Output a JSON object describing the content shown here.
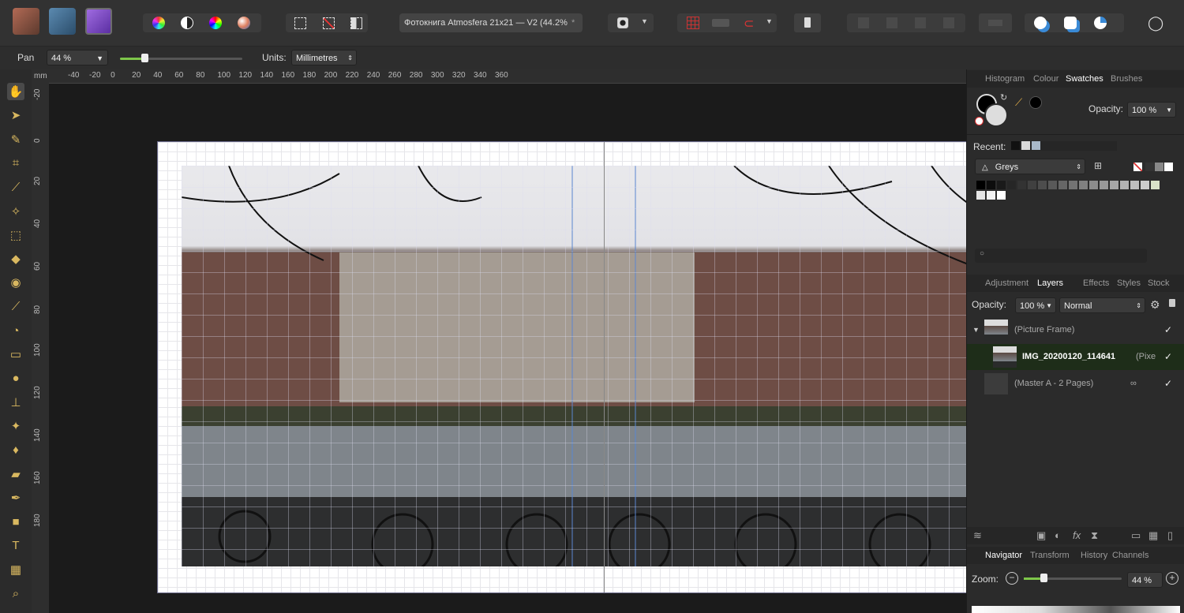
{
  "toolbar": {
    "personas": [
      "photo-persona",
      "designer-persona",
      "publisher-persona"
    ],
    "document_title": "Фотокнига Atmosfera 21x21 — V2 (44.2%",
    "modified_mark": "*",
    "dropdown_glyph": "▼"
  },
  "context": {
    "tool": "Pan",
    "zoom_value": "44 %",
    "zoom_slider_level": 0.2,
    "units_label": "Units:",
    "units_value": "Millimetres"
  },
  "ruler": {
    "unit": "mm",
    "h_labels": [
      "-40",
      "-20",
      "0",
      "20",
      "40",
      "60",
      "80",
      "100",
      "120",
      "140",
      "160",
      "180",
      "200",
      "220",
      "240",
      "260",
      "280",
      "300",
      "320",
      "340",
      "360"
    ],
    "v_labels": [
      "-20",
      "0",
      "20",
      "40",
      "60",
      "80",
      "100",
      "120",
      "140",
      "160",
      "180"
    ]
  },
  "tools": [
    "hand-icon",
    "pointer-icon",
    "eyedropper-icon",
    "crop-icon",
    "brush-icon",
    "wand-icon",
    "marquee-icon",
    "fill-icon",
    "color-picker-icon",
    "paint-icon",
    "recolor-icon",
    "eraser-icon",
    "search-icon",
    "stamp-icon",
    "retouch-icon",
    "drop-icon",
    "bandage-icon",
    "pen-icon",
    "rectangle-icon",
    "text-icon",
    "grid-icon",
    "zoom-icon"
  ],
  "swatches_panel": {
    "tabs": [
      "Histogram",
      "Colour",
      "Swatches",
      "Brushes"
    ],
    "active_tab": "Swatches",
    "opacity_label": "Opacity:",
    "opacity_value": "100 %",
    "recent_label": "Recent:",
    "recent_colors": [
      "#111111",
      "#d9d9d9",
      "#a9b9c9"
    ],
    "palette_name": "Greys",
    "greys": [
      "#000000",
      "#0d0d0d",
      "#1a1a1a",
      "#262626",
      "#333333",
      "#404040",
      "#4d4d4d",
      "#595959",
      "#666666",
      "#737373",
      "#808080",
      "#8c8c8c",
      "#999999",
      "#a6a6a6",
      "#b3b3b3",
      "#bfbfbf",
      "#cccccc",
      "#d9e3c9",
      "#e6e6e6",
      "#f2f2f2",
      "#ffffff"
    ]
  },
  "layers_panel": {
    "tabs": [
      "Adjustment",
      "Layers",
      "Effects",
      "Styles",
      "Stock"
    ],
    "active_tab": "Layers",
    "opacity_label": "Opacity:",
    "opacity_value": "100 %",
    "blend_mode": "Normal",
    "layers": [
      {
        "name": "(Picture Frame)",
        "visible": true
      },
      {
        "name": "IMG_20200120_114641",
        "suffix": "(Pixe",
        "visible": true
      },
      {
        "name": "(Master A - 2 Pages)",
        "visible": true
      }
    ]
  },
  "navigator_panel": {
    "tabs": [
      "Navigator",
      "Transform",
      "History",
      "Channels"
    ],
    "active_tab": "Navigator",
    "zoom_label": "Zoom:",
    "zoom_value": "44 %",
    "zoom_slider_level": 0.2
  },
  "colors": {
    "accent": "#7a5cc7",
    "selection": "#1e2d19",
    "photo_persona": "#8b5a4a",
    "designer_persona": "#3a5a7a",
    "publisher_persona": "#7a4db0"
  }
}
